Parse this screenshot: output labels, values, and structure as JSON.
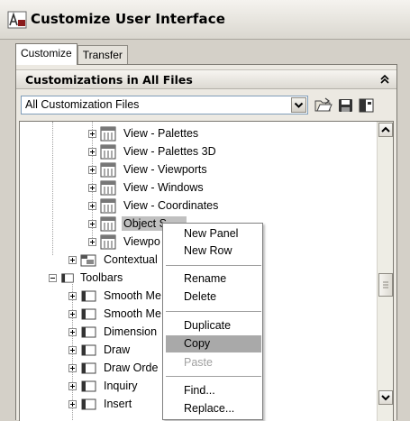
{
  "window": {
    "title": "Customize User Interface",
    "app_icon": "autocad-app-icon"
  },
  "tabs": [
    {
      "label": "Customize",
      "active": true
    },
    {
      "label": "Transfer",
      "active": false
    }
  ],
  "section": {
    "title": "Customizations in All Files",
    "collapse_icon": "double-chevron-up-icon"
  },
  "file_selector": {
    "value": "All Customization Files"
  },
  "tree": {
    "items": [
      {
        "label": "View - Palettes",
        "icon": "ribbon-panel-icon"
      },
      {
        "label": "View - Palettes 3D",
        "icon": "ribbon-panel-icon"
      },
      {
        "label": "View - Viewports",
        "icon": "ribbon-panel-icon"
      },
      {
        "label": "View - Windows",
        "icon": "ribbon-panel-icon"
      },
      {
        "label": "View - Coordinates",
        "icon": "ribbon-panel-icon"
      },
      {
        "label": "Object S",
        "icon": "ribbon-panel-icon",
        "selected": true
      },
      {
        "label": "Viewpo",
        "icon": "ribbon-panel-icon"
      },
      {
        "label": "Contextual",
        "icon": "contextual-tab-icon"
      },
      {
        "label": "Toolbars",
        "icon": "toolbar-icon",
        "expanded": true
      },
      {
        "label": "Smooth Me",
        "icon": "toolbar-icon"
      },
      {
        "label": "Smooth Me",
        "icon": "toolbar-icon"
      },
      {
        "label": "Dimension",
        "icon": "toolbar-icon"
      },
      {
        "label": "Draw",
        "icon": "toolbar-icon"
      },
      {
        "label": "Draw Orde",
        "icon": "toolbar-icon"
      },
      {
        "label": "Inquiry",
        "icon": "toolbar-icon"
      },
      {
        "label": "Insert",
        "icon": "toolbar-icon"
      }
    ]
  },
  "context_menu": {
    "items": [
      {
        "label": "New Panel"
      },
      {
        "label": "New Row"
      },
      {
        "label": "Rename"
      },
      {
        "label": "Delete"
      },
      {
        "label": "Duplicate"
      },
      {
        "label": "Copy",
        "highlighted": true
      },
      {
        "label": "Paste",
        "disabled": true
      },
      {
        "label": "Find..."
      },
      {
        "label": "Replace..."
      }
    ]
  },
  "colors": {
    "highlight": "#a9a9a9",
    "selection": "#c0c0c0",
    "dialog_bg": "#d4d0c8"
  }
}
